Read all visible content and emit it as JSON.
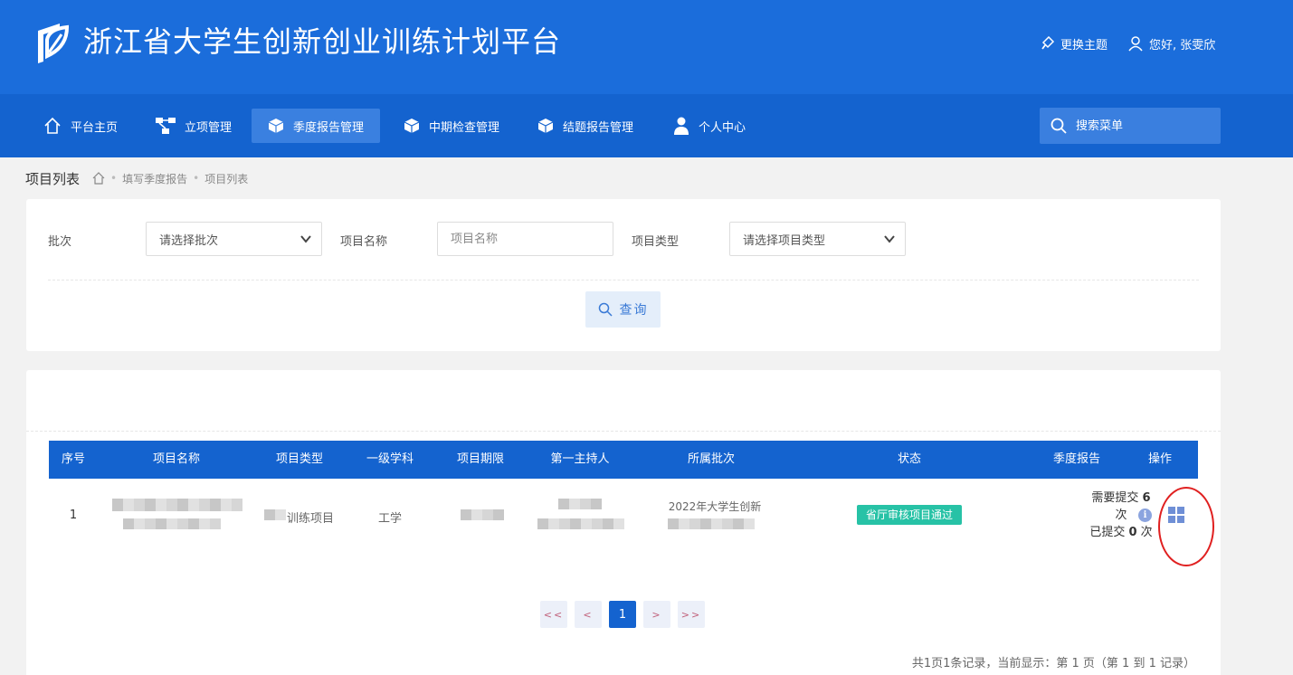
{
  "header": {
    "site_title": "浙江省大学生创新创业训练计划平台",
    "theme_label": "更换主题",
    "user_greeting": "您好, 张雯欣"
  },
  "nav": {
    "items": [
      {
        "label": "平台主页",
        "icon": "home-icon"
      },
      {
        "label": "立项管理",
        "icon": "sitemap-icon"
      },
      {
        "label": "季度报告管理",
        "icon": "cube-icon",
        "active": true
      },
      {
        "label": "中期检查管理",
        "icon": "cube-icon"
      },
      {
        "label": "结题报告管理",
        "icon": "cube-icon"
      },
      {
        "label": "个人中心",
        "icon": "user-icon"
      }
    ],
    "search_placeholder": "搜索菜单"
  },
  "breadcrumb": {
    "page_title": "项目列表",
    "items": [
      "填写季度报告",
      "项目列表"
    ]
  },
  "filters": {
    "batch_label": "批次",
    "batch_value": "请选择批次",
    "name_label": "项目名称",
    "name_placeholder": "项目名称",
    "type_label": "项目类型",
    "type_value": "请选择项目类型",
    "query_label": "查询"
  },
  "table": {
    "columns": [
      "序号",
      "项目名称",
      "项目类型",
      "一级学科",
      "项目期限",
      "第一主持人",
      "所属批次",
      "状态",
      "季度报告",
      "操作"
    ],
    "rows": [
      {
        "index": "1",
        "project_type_fragment": "训练项目",
        "discipline_fragment": "工学",
        "batch_fragment": "2022年大学生创新",
        "status": "省厅审核项目通过",
        "report_required_prefix": "需要提交",
        "report_required_count": "6",
        "report_required_suffix": "次",
        "report_submitted_prefix": "已提交",
        "report_submitted_count": "0",
        "report_submitted_suffix": "次"
      }
    ]
  },
  "pagination": {
    "first": "<<",
    "prev": "<",
    "current": "1",
    "next": ">",
    "last": ">>",
    "summary": "共1页1条记录，当前显示：第 1 页（第 1 到 1 记录）"
  },
  "colors": {
    "header_bg": "#1b6ddb",
    "nav_bg": "#1463cf",
    "status_badge": "#27c2a6",
    "annotation": "#e02020"
  }
}
